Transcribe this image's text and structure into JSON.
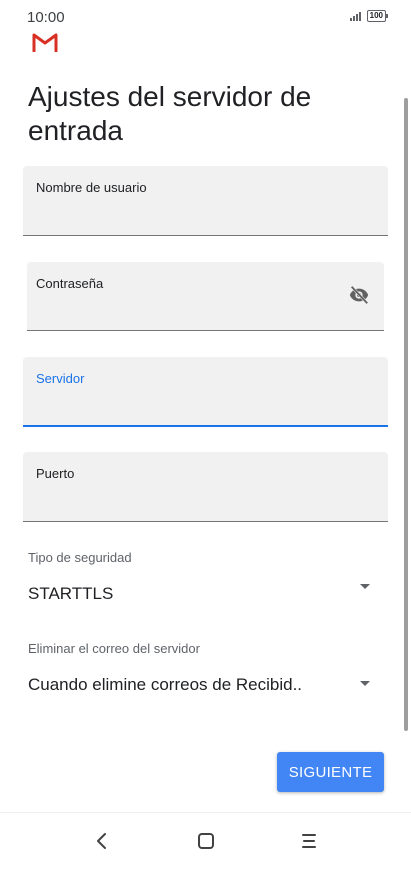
{
  "status_bar": {
    "time": "10:00",
    "battery": "100",
    "icons": [
      "signal-icon",
      "battery-icon"
    ]
  },
  "app": {
    "logo": "gmail-icon"
  },
  "page": {
    "title": "Ajustes del servidor de entrada"
  },
  "form": {
    "username": {
      "label": "Nombre de usuario",
      "value": ""
    },
    "password": {
      "label": "Contraseña",
      "value": "",
      "toggle_icon": "visibility-off-icon"
    },
    "server": {
      "label": "Servidor",
      "value": "",
      "focused": true
    },
    "port": {
      "label": "Puerto",
      "value": ""
    },
    "security_type": {
      "label": "Tipo de seguridad",
      "value": "STARTTLS"
    },
    "delete_from_server": {
      "label": "Eliminar el correo del servidor",
      "value": "Cuando elimine correos de Recibid.."
    }
  },
  "actions": {
    "next_label": "SIGUIENTE"
  },
  "nav_bar": {
    "icons": [
      "back-icon",
      "home-icon",
      "menu-icon"
    ]
  },
  "colors": {
    "accent": "#1a73e8",
    "button": "#4285f4",
    "field_bg": "#f1f1f1",
    "gmail_red": "#d93025"
  }
}
